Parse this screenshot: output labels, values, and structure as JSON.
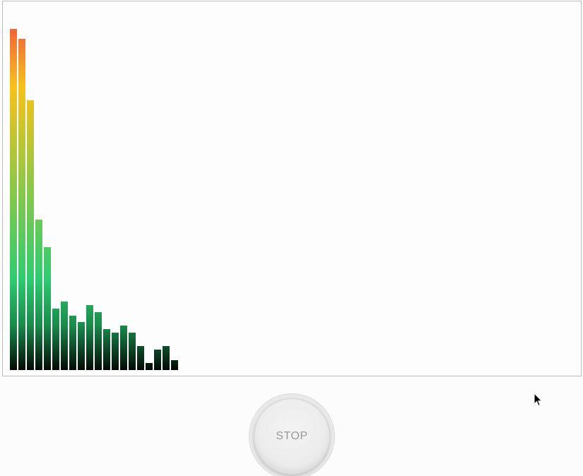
{
  "visualizer": {
    "bar_values": [
      100,
      97,
      79,
      44,
      36,
      18,
      20,
      16,
      14,
      19,
      17,
      12,
      11,
      13,
      11,
      7,
      2,
      6,
      7,
      3
    ],
    "max_value": 100,
    "gradient_colors": {
      "top": "#f0643a",
      "upper": "#f6c21a",
      "middle": "#2ecc71",
      "lower": "#1a8a4c",
      "bottom": "#020a05"
    }
  },
  "controls": {
    "stop_label": "STOP"
  },
  "cursor": {
    "icon": "arrow-cursor-icon"
  }
}
